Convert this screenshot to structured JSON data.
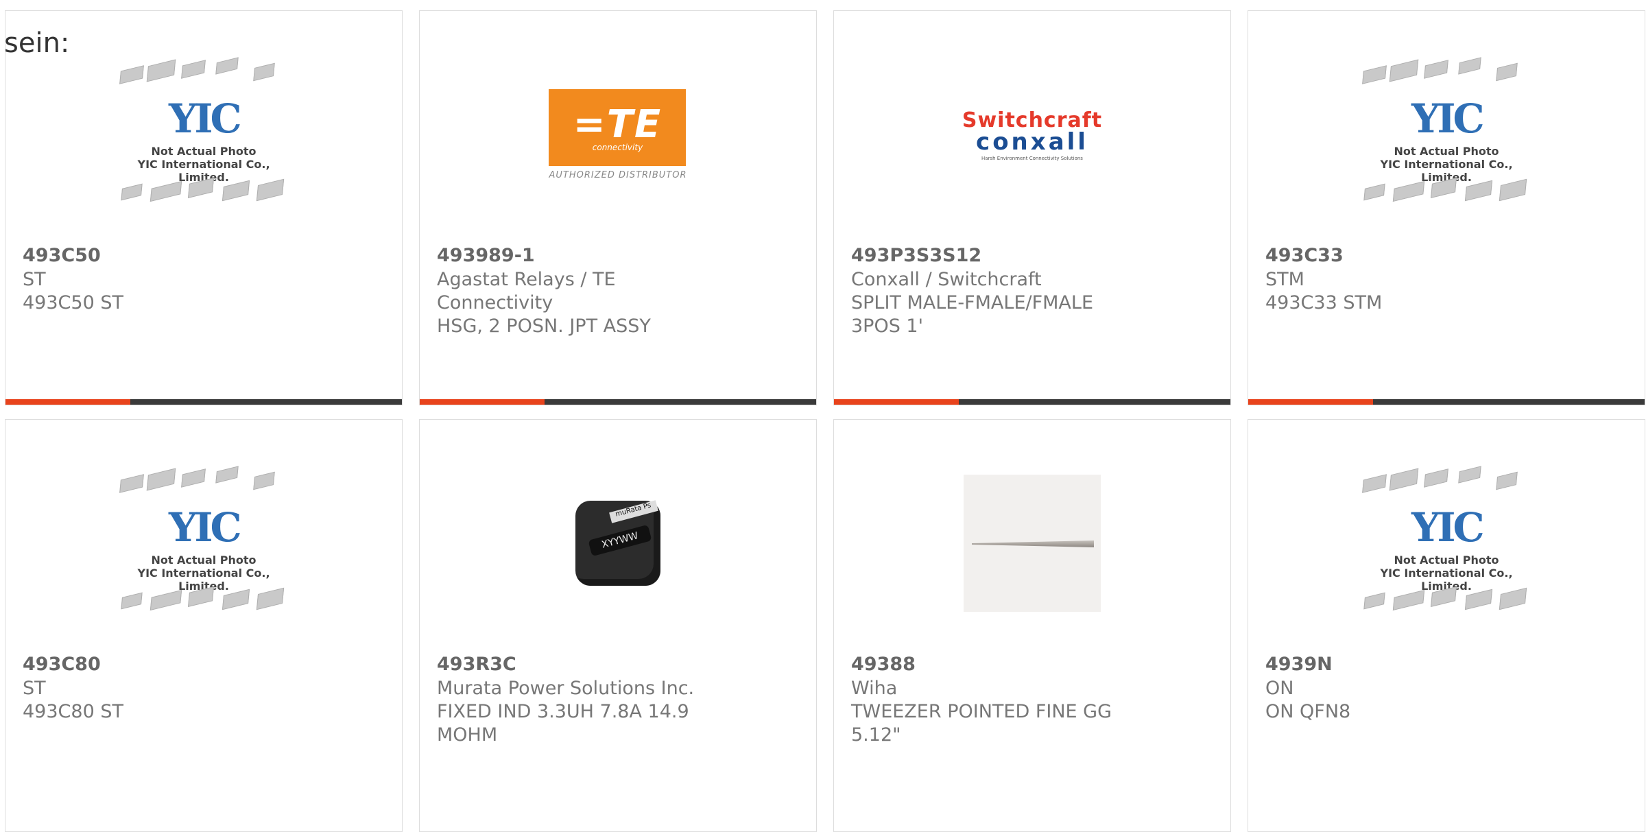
{
  "lead_text": "sein:",
  "products": [
    {
      "part": "493C50",
      "manufacturer": "ST",
      "description": "493C50 ST",
      "image": "yic-placeholder"
    },
    {
      "part": "493989-1",
      "manufacturer": "Agastat Relays / TE Connectivity",
      "description": "HSG, 2 POSN. JPT ASSY",
      "image": "te-logo"
    },
    {
      "part": "493P3S3S12",
      "manufacturer": "Conxall / Switchcraft",
      "description": "SPLIT MALE-FMALE/FMALE 3POS 1'",
      "image": "switchcraft-logo"
    },
    {
      "part": "493C33",
      "manufacturer": "STM",
      "description": "493C33 STM",
      "image": "yic-placeholder"
    },
    {
      "part": "493C80",
      "manufacturer": "ST",
      "description": "493C80 ST",
      "image": "yic-placeholder"
    },
    {
      "part": "493R3C",
      "manufacturer": "Murata Power Solutions Inc.",
      "description": "FIXED IND 3.3UH 7.8A 14.9 MOHM",
      "image": "inductor-photo"
    },
    {
      "part": "49388",
      "manufacturer": "Wiha",
      "description": "TWEEZER POINTED FINE GG 5.12\"",
      "image": "tweezer-photo"
    },
    {
      "part": "4939N",
      "manufacturer": "ON",
      "description": "ON QFN8",
      "image": "yic-placeholder"
    }
  ],
  "yic": {
    "logo": "YIC",
    "line1": "Not Actual Photo",
    "line2": "YIC International Co., Limited."
  },
  "te": {
    "logo": "=TE",
    "sub": "connectivity",
    "dist": "AUTHORIZED DISTRIBUTOR"
  },
  "switchcraft": {
    "line1": "Switchcraft",
    "line2": "conxall",
    "line3": "Harsh Environment Connectivity Solutions"
  },
  "inductor": {
    "top": "muRata Ps",
    "label": "XYYWW"
  },
  "colors": {
    "accent_red": "#e8431c",
    "accent_dark": "#3a3a3a",
    "border": "#dddddd"
  }
}
